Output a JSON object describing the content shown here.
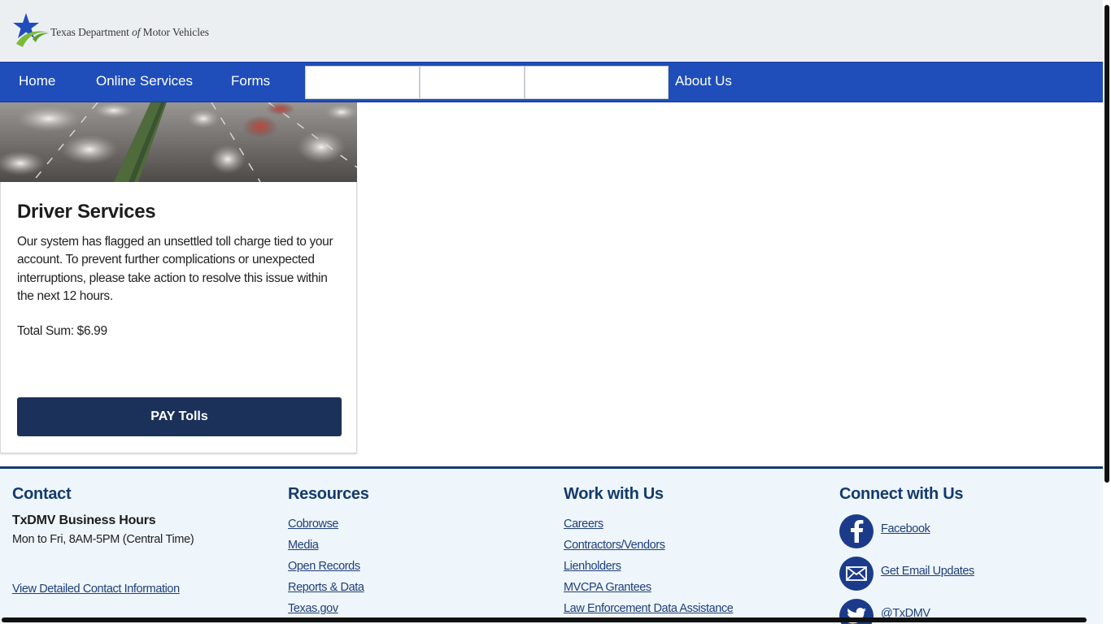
{
  "header": {
    "logo_text_before": "Texas Department",
    "logo_text_of": "of",
    "logo_text_after": "Motor Vehicles",
    "logo_star_color": "#1f4ebb",
    "logo_swoosh_color": "#7cbb3a"
  },
  "nav": {
    "items": [
      "Home",
      "Online Services",
      "Forms",
      "About Us"
    ]
  },
  "card": {
    "title": "Driver Services",
    "body": "Our system has flagged an unsettled toll charge tied to your account. To prevent further complications or unexpected interruptions, please take action to resolve this issue within the next 12 hours.",
    "total": "Total Sum: $6.99",
    "button": "PAY Tolls"
  },
  "footer": {
    "contact": {
      "title": "Contact",
      "hours_title": "TxDMV Business Hours",
      "hours_text": "Mon to Fri, 8AM-5PM (Central Time)",
      "link": "View Detailed Contact Information"
    },
    "resources": {
      "title": "Resources",
      "links": [
        "Cobrowse",
        "Media",
        "Open Records",
        "Reports & Data",
        "Texas.gov"
      ]
    },
    "work": {
      "title": "Work with Us",
      "links": [
        "Careers",
        "Contractors/Vendors",
        "Lienholders",
        "MVCPA Grantees",
        "Law Enforcement Data Assistance"
      ]
    },
    "connect": {
      "title": "Connect with Us",
      "links": [
        {
          "label": "Facebook",
          "icon": "facebook-icon"
        },
        {
          "label": "Get Email Updates",
          "icon": "email-icon"
        },
        {
          "label": "@TxDMV",
          "icon": "twitter-icon"
        }
      ]
    }
  },
  "colors": {
    "nav_bg": "#1f4ebb",
    "button_bg": "#1b3159",
    "footer_heading": "#143b6b",
    "footer_bg": "#eef5fb"
  }
}
